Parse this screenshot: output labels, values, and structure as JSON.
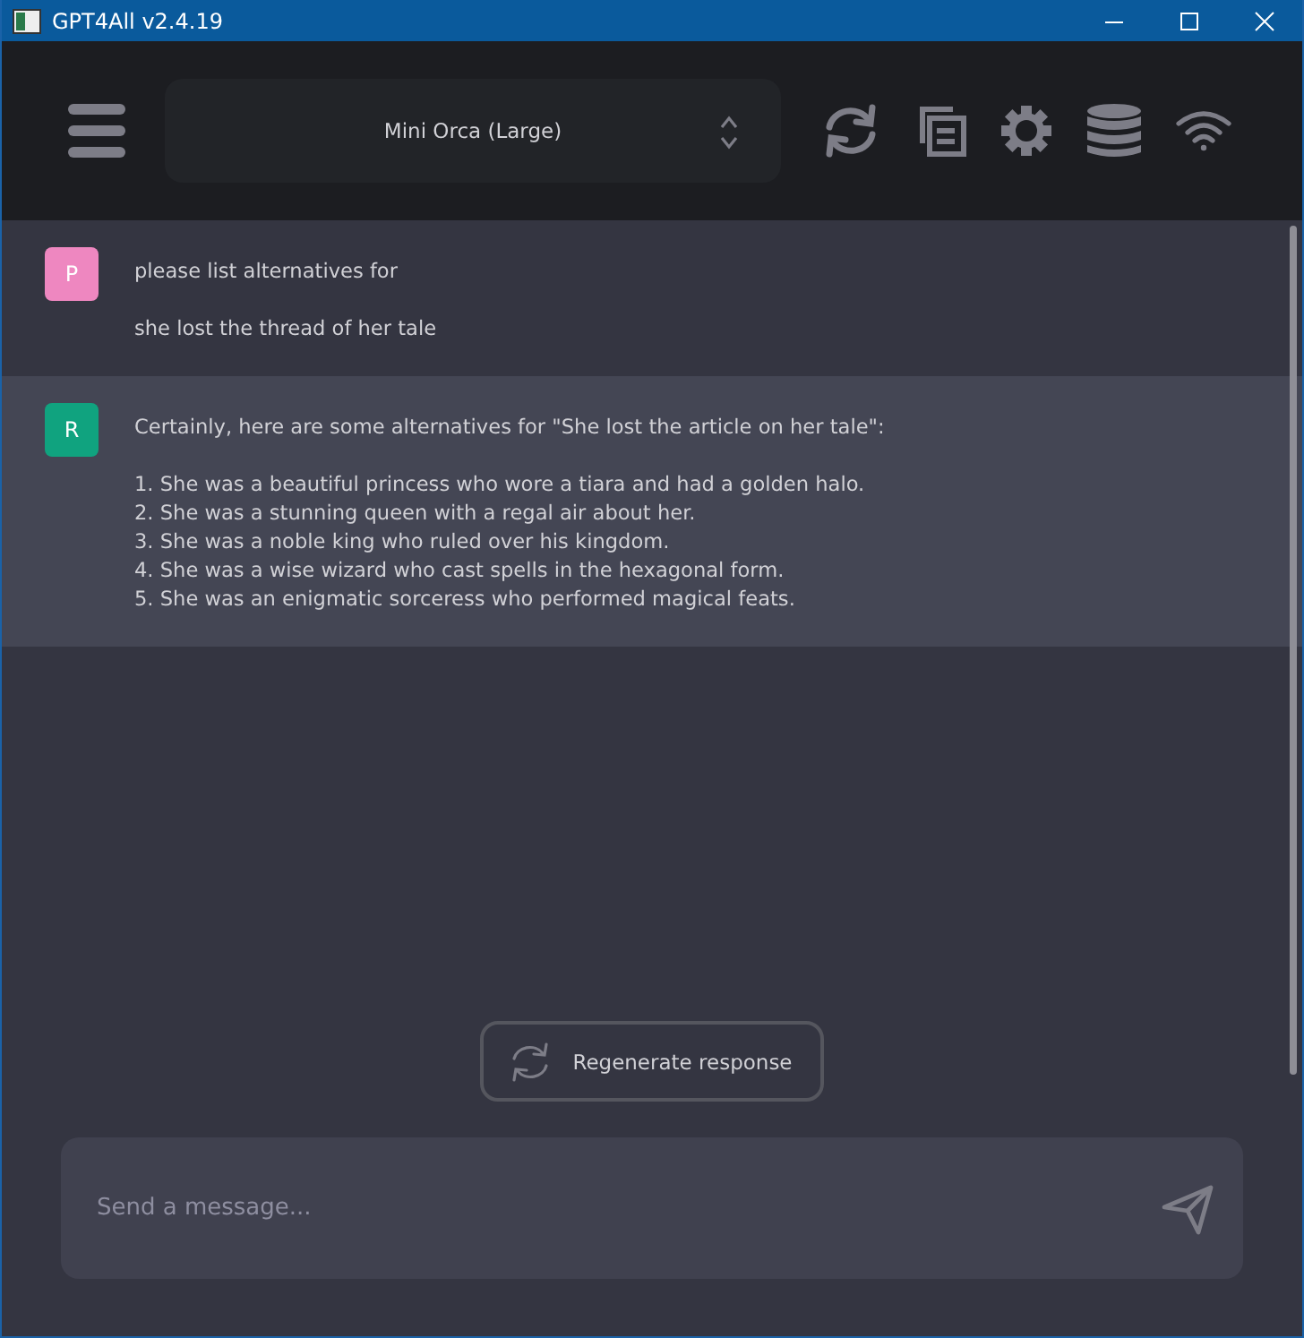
{
  "window": {
    "title": "GPT4All v2.4.19"
  },
  "header": {
    "model": "Mini Orca (Large)"
  },
  "messages": [
    {
      "kind": "prompt",
      "avatar": "P",
      "color": "#ee87c0",
      "paragraphs": [
        [
          "please list alternatives for"
        ],
        [
          "she lost the thread of her tale"
        ]
      ]
    },
    {
      "kind": "response",
      "avatar": "R",
      "color": "#10a37f",
      "paragraphs": [
        [
          "Certainly, here are some alternatives for \"She lost the article on her tale\":"
        ],
        [
          "1. She was a beautiful princess who wore a tiara and had a golden halo.",
          "2. She was a stunning queen with a regal air about her.",
          "3. She was a noble king who ruled over his kingdom.",
          "4. She was a wise wizard who cast spells in the hexagonal form.",
          "5. She was an enigmatic sorceress who performed magical feats."
        ]
      ]
    }
  ],
  "regenerate_button": "Regenerate response",
  "input": {
    "placeholder": "Send a message..."
  }
}
